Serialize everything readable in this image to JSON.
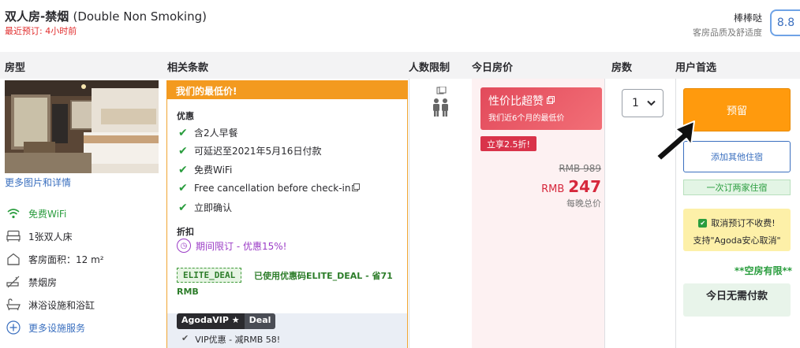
{
  "header": {
    "room_title": "双人房-禁烟",
    "room_title_en": "(Double Non Smoking)",
    "last_booked": "最近预订: 4小时前",
    "score_label": "棒棒哒",
    "score_sub": "客房品质及舒适度",
    "score": "8.8"
  },
  "columns": {
    "room_type": "房型",
    "terms": "相关条款",
    "occupancy": "人数限制",
    "price": "今日房价",
    "rooms": "房数",
    "user_choice": "用户首选"
  },
  "room": {
    "more_photos": "更多图片和详情",
    "features": [
      {
        "label": "免费WiFi",
        "icon": "wifi-icon"
      },
      {
        "label": "1张双人床",
        "icon": "bed-icon"
      },
      {
        "label": "客房面积：12 m²",
        "icon": "house-icon"
      },
      {
        "label": "禁烟房",
        "icon": "no-smoking-icon"
      },
      {
        "label": "淋浴设施和浴缸",
        "icon": "bathtub-icon"
      },
      {
        "label": "更多设施服务",
        "icon": "plus-circle-icon"
      }
    ]
  },
  "terms": {
    "lowest_banner": "我们的最低价!",
    "benefits_title": "优惠",
    "benefits": [
      "含2人早餐",
      "可延迟至2021年5月16日付款",
      "免费WiFi",
      "Free cancellation before check-in",
      "立即确认"
    ],
    "discount_title": "折扣",
    "limited_offer": "期间限订 - 优惠15%!",
    "elite_code": "ELITE_DEAL",
    "elite_used": "已使用优惠码ELITE_DEAL - 省71",
    "elite_rmb": "RMB",
    "vip_tag_a": "AgodaVIP",
    "vip_tag_b": "Deal",
    "vip_line": "VIP优惠 - 减RMB 58!"
  },
  "price": {
    "value_title": "性价比超赞",
    "value_sub": "我们近6个月的最低价",
    "discount_tag": "立享2.5折!",
    "original": "RMB 989",
    "currency": "RMB",
    "current": "247",
    "per_night": "每晚总价"
  },
  "rooms": {
    "selected": "1"
  },
  "actions": {
    "book": "预留",
    "add_stay": "添加其他住宿",
    "two_stays": "一次订两家住宿",
    "cancel_line1": "取消预订不收费!",
    "cancel_line2": "支持\"Agoda安心取消\"",
    "rooms_limited": "**空房有限**",
    "pay_none": "今日无需付款"
  },
  "colors": {
    "accent_orange": "#ff9a0d",
    "price_red": "#d6283c",
    "link_blue": "#3a6fbf",
    "success_green": "#2a9d3e"
  }
}
